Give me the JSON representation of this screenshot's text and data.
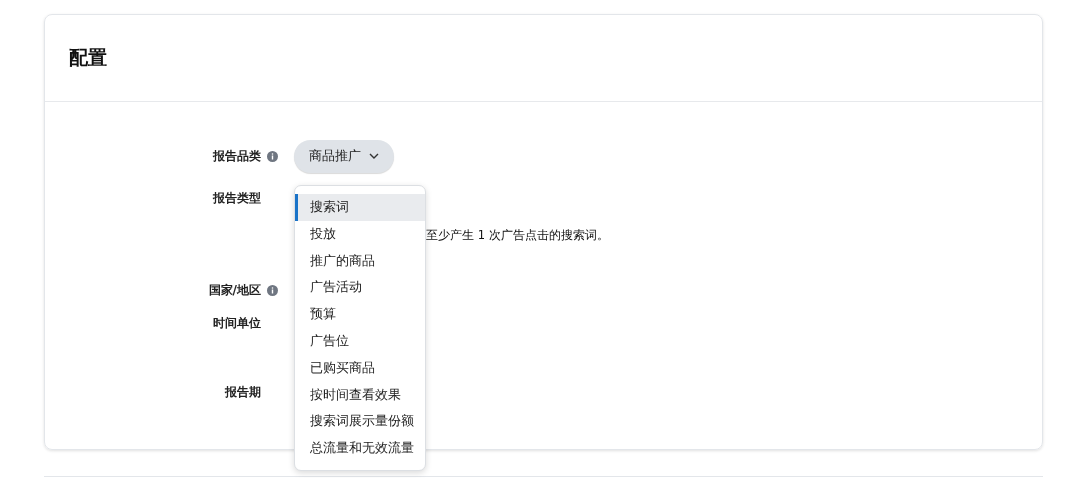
{
  "card": {
    "title": "配置"
  },
  "fields": [
    {
      "label": "报告品类",
      "info": true,
      "kind": "select",
      "value": "商品推广"
    },
    {
      "label": "报告类型",
      "info": false,
      "kind": "dropdown-anchor",
      "hint": "至少产生 1 次广告点击的搜索词。"
    },
    {
      "label": "国家/地区",
      "info": true,
      "kind": "empty"
    },
    {
      "label": "时间单位",
      "info": false,
      "kind": "empty"
    },
    {
      "label": "报告期",
      "info": false,
      "kind": "empty"
    }
  ],
  "menu": {
    "items": [
      {
        "label": "搜索词",
        "selected": true
      },
      {
        "label": "投放",
        "selected": false
      },
      {
        "label": "推广的商品",
        "selected": false
      },
      {
        "label": "广告活动",
        "selected": false
      },
      {
        "label": "预算",
        "selected": false
      },
      {
        "label": "广告位",
        "selected": false
      },
      {
        "label": "已购买商品",
        "selected": false
      },
      {
        "label": "按时间查看效果",
        "selected": false
      },
      {
        "label": "搜索词展示量份额",
        "selected": false
      },
      {
        "label": "总流量和无效流量",
        "selected": false
      }
    ]
  }
}
